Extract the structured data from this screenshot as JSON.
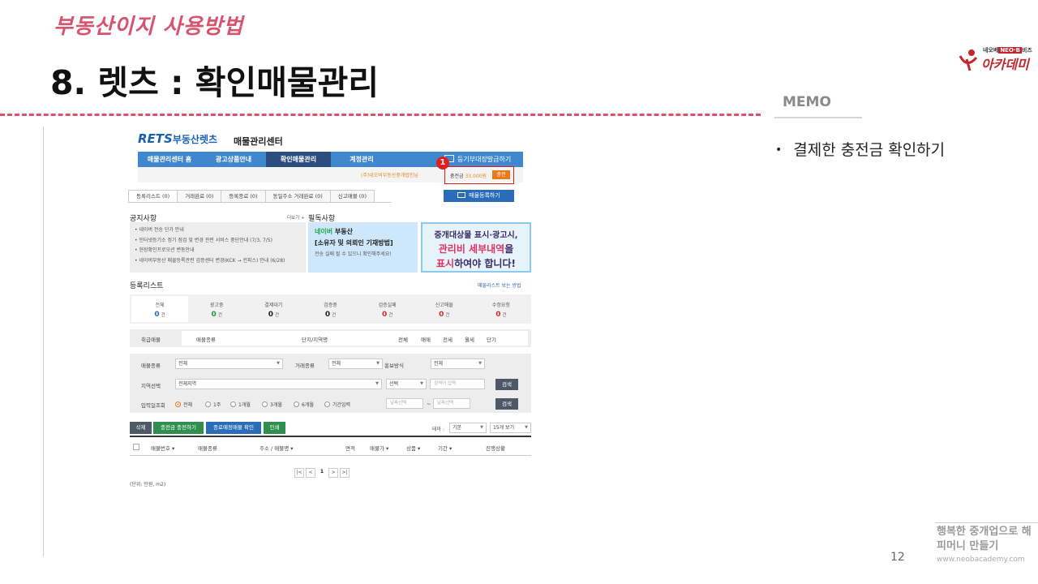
{
  "slide": {
    "subtitle": "부동산이지 사용방법",
    "title": "8. 렛츠 : 확인매물관리",
    "page_number": "12",
    "footer_text": "행복한 중개업으로 해피머니 만들기",
    "footer_url": "www.neobacademy.com"
  },
  "logo": {
    "small_prefix": "네오베",
    "small_neo": "NEO·B",
    "small_suffix": "비즈",
    "big": "아카데미"
  },
  "memo": {
    "title": "MEMO",
    "bullet": "•",
    "item": "결제한 충전금 확인하기"
  },
  "rets": {
    "logo_en": "RETS",
    "logo_kr": "부동산렛츠",
    "center_title": "매물관리센터",
    "nav": [
      "매물관리센터 홈",
      "광고상품안내",
      "확인매물관리",
      "계정관리"
    ],
    "nav_extra": "등기부대장발급하기",
    "agent_text": "(주)네오비부동산중개법인님",
    "charge_label": "충전금",
    "charge_amount": "33,000원",
    "charge_button": "충전",
    "badge": "1",
    "tabs": [
      "등록리스트 (0)",
      "거래완료 (0)",
      "등록종료 (0)",
      "동일주소 거래완료 (0)",
      "신고매물 (0)"
    ],
    "register_button": "매물등록하기",
    "notice_title": "공지사항",
    "more_link": "더보기 +",
    "notices": [
      "• 네이버 전송 단가 안내",
      "• 인터넷등기소 정기 점검 및 변경 관련 서비스 중단안내 (7/3, 7/5)",
      "• 현장확인프로모션 변동안내",
      "• 네이버부동산 매물등록관련 검증센터 변경(KCK → 컨피스) 안내 (6/28)"
    ],
    "must_title": "필독사항",
    "naver_brand": "네이버",
    "naver_suffix": "부동산",
    "naver_line2": "[소유자 및 의뢰인 기재방법]",
    "naver_line3": "전송 실패 될 수 있으니 확인해주세요!",
    "banner_line1": "중개대상물 표시·광고시,",
    "banner_hl1": "관리비 세부내역",
    "banner_tail1": "을",
    "banner_hl2": "표시",
    "banner_tail2": "하여야 합니다!",
    "list_title": "등록리스트",
    "list_guide": "매물리스트 보는 방법",
    "stats": [
      {
        "label": "전체",
        "value": "0",
        "unit": "건"
      },
      {
        "label": "광고중",
        "value": "0",
        "unit": "건"
      },
      {
        "label": "결제대기",
        "value": "0",
        "unit": "건"
      },
      {
        "label": "검증중",
        "value": "0",
        "unit": "건"
      },
      {
        "label": "검증실패",
        "value": "0",
        "unit": "건"
      },
      {
        "label": "신고매물",
        "value": "0",
        "unit": "건"
      },
      {
        "label": "수정요청",
        "value": "0",
        "unit": "건"
      }
    ],
    "filter1": {
      "label": "취급매물",
      "cols": [
        "매물종류",
        "단지/지역명",
        "전체",
        "매매",
        "전세",
        "월세",
        "단기"
      ]
    },
    "filter2": {
      "type_label": "매물종류",
      "type_value": "전체",
      "deal_label": "거래종류",
      "deal_value": "전체",
      "promo_label": "홍보방식",
      "promo_value": "전체",
      "region_label": "지역선택",
      "region_value": "전체지역",
      "select_value": "선택",
      "keyword_placeholder": "검색어 입력",
      "search_button": "검색",
      "date_label": "입력일조회",
      "radios": [
        "전체",
        "1주",
        "1개월",
        "3개월",
        "6개월",
        "기간입력"
      ],
      "date_placeholder": "날짜선택",
      "tilde": "~"
    },
    "actions": [
      "삭제",
      "충전금 충전하기",
      "종료예정매물 확인",
      "인쇄"
    ],
    "theme_label": "테마 :",
    "theme_value": "기본",
    "per_page": "15개 보기",
    "table_headers": [
      "매물번호 ▾",
      "매물종류",
      "주소 / 매물명 ▾",
      "면적",
      "매물가 ▾",
      "상품 ▾",
      "기간 ▾",
      "진행상황"
    ],
    "pager": [
      "|<",
      "<",
      "1",
      ">",
      ">|"
    ],
    "unit_note": "(단위: 만원, m2)"
  },
  "colors": {
    "accent_pink": "#d9536f",
    "nav_blue": "#3f88cf",
    "nav_active": "#2b4d80",
    "highlight_red": "#e41d1d",
    "charge_orange": "#e87a1b"
  }
}
